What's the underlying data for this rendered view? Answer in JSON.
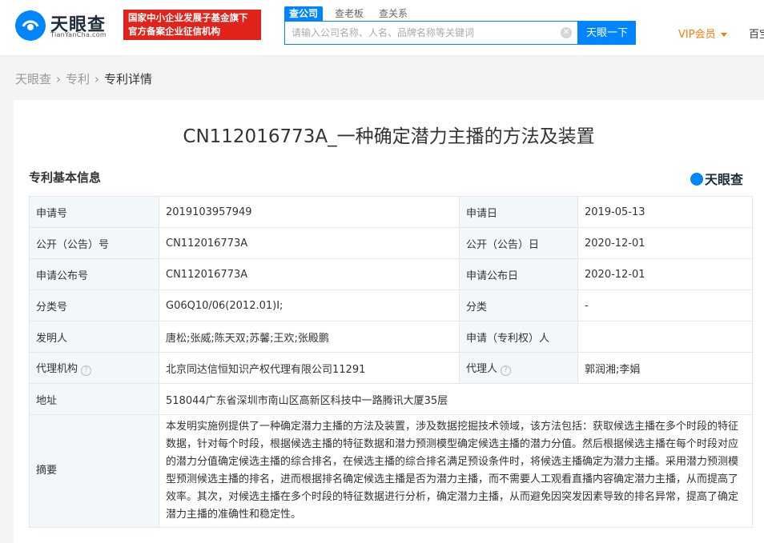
{
  "header": {
    "logo_text": "天眼查",
    "logo_sub": "TianYanCha.com",
    "gov_badge_line1": "国家中小企业发展子基金旗下",
    "gov_badge_line2": "官方备案企业征信机构",
    "search_tabs": [
      "查公司",
      "查老板",
      "查关系"
    ],
    "search_placeholder": "请输入公司名称、人名、品牌名称等关键词",
    "search_button": "天眼一下",
    "vip_label": "VIP会员",
    "more_link": "百宝"
  },
  "breadcrumb": [
    "天眼查",
    "专利",
    "专利详情"
  ],
  "page_title": "CN112016773A_一种确定潜力主播的方法及装置",
  "section_title": "专利基本信息",
  "section_logo": "天眼查",
  "fields": {
    "application_no_label": "申请号",
    "application_no": "2019103957949",
    "application_date_label": "申请日",
    "application_date": "2019-05-13",
    "publication_no_label": "公开（公告）号",
    "publication_no": "CN112016773A",
    "publication_date_label": "公开（公告）日",
    "publication_date": "2020-12-01",
    "app_pub_no_label": "申请公布号",
    "app_pub_no": "CN112016773A",
    "app_pub_date_label": "申请公布日",
    "app_pub_date": "2020-12-01",
    "classification_no_label": "分类号",
    "classification_no": "G06Q10/06(2012.01)I;",
    "classification_label": "分类",
    "classification": "-",
    "inventor_label": "发明人",
    "inventor": "唐松;张威;陈天双;苏馨;王欢;张殿鹏",
    "applicant_label": "申请（专利权）人",
    "applicant": "",
    "agency_label": "代理机构",
    "agency": "北京同达信恒知识产权代理有限公司11291",
    "agent_label": "代理人",
    "agent": "郭润湘;李娟",
    "address_label": "地址",
    "address": "518044广东省深圳市南山区高新区科技中一路腾讯大厦35层",
    "abstract_label": "摘要",
    "abstract": "本发明实施例提供了一种确定潜力主播的方法及装置，涉及数据挖掘技术领域，该方法包括：获取候选主播在多个时段的特征数据，针对每个时段，根据候选主播的特征数据和潜力预测模型确定候选主播的潜力分值。然后根据候选主播在每个时段对应的潜力分值确定候选主播的综合排名，在候选主播的综合排名满足预设条件时，将候选主播确定为潜力主播。采用潜力预测模型预测候选主播的排名，进而根据排名确定候选主播是否为潜力主播，而不需要人工观看直播内容确定潜力主播，从而提高了效率。其次，对候选主播在多个时段的特征数据进行分析，确定潜力主播，从而避免因突发因素导致的排名异常，提高了确定潜力主播的准确性和稳定性。"
  },
  "colors": {
    "brand_blue": "#0084ff",
    "gov_red": "#e0241b",
    "vip_orange": "#ff7a00",
    "label_bg": "#f2f7fc"
  }
}
